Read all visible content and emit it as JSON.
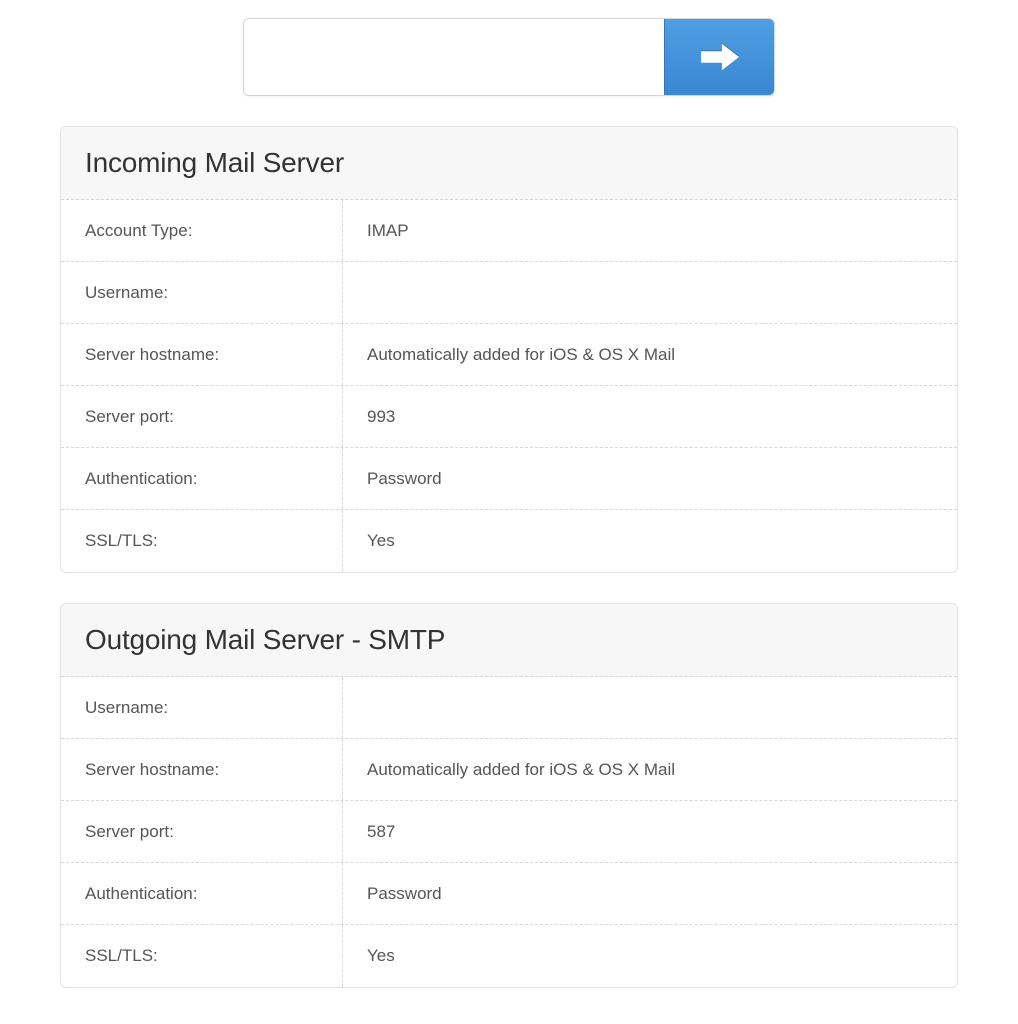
{
  "search": {
    "value": ""
  },
  "incoming": {
    "title": "Incoming Mail Server",
    "rows": {
      "account_type": {
        "label": "Account Type:",
        "value": "IMAP"
      },
      "username": {
        "label": "Username:",
        "value": ""
      },
      "server_hostname": {
        "label": "Server hostname:",
        "value": "Automatically added for iOS & OS X Mail"
      },
      "server_port": {
        "label": "Server port:",
        "value": "993"
      },
      "authentication": {
        "label": "Authentication:",
        "value": "Password"
      },
      "ssl_tls": {
        "label": "SSL/TLS:",
        "value": "Yes"
      }
    }
  },
  "outgoing": {
    "title": "Outgoing Mail Server - SMTP",
    "rows": {
      "username": {
        "label": "Username:",
        "value": ""
      },
      "server_hostname": {
        "label": "Server hostname:",
        "value": "Automatically added for iOS & OS X Mail"
      },
      "server_port": {
        "label": "Server port:",
        "value": "587"
      },
      "authentication": {
        "label": "Authentication:",
        "value": "Password"
      },
      "ssl_tls": {
        "label": "SSL/TLS:",
        "value": "Yes"
      }
    }
  }
}
